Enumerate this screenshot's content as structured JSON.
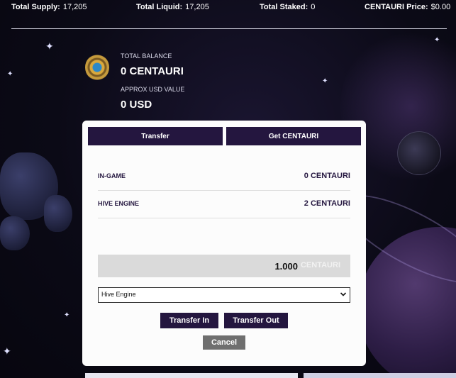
{
  "stats": {
    "total_supply": {
      "label": "Total Supply:",
      "value": "17,205"
    },
    "total_liquid": {
      "label": "Total Liquid:",
      "value": "17,205"
    },
    "total_staked": {
      "label": "Total Staked:",
      "value": "0"
    },
    "price": {
      "label": "CENTAURI Price:",
      "value": "$0.00"
    }
  },
  "balance": {
    "coin_icon": "centauri-coin-icon",
    "total_label": "TOTAL BALANCE",
    "total_value": "0 CENTAURI",
    "usd_label": "APPROX USD VALUE",
    "usd_value": "0 USD"
  },
  "card": {
    "tabs": [
      {
        "label": "Transfer"
      },
      {
        "label": "Get CENTAURI"
      }
    ],
    "rows": [
      {
        "label": "IN-GAME",
        "amount": "0 CENTAURI"
      },
      {
        "label": "HIVE ENGINE",
        "amount": "2 CENTAURI"
      }
    ],
    "amount_input": {
      "value": "1.000",
      "unit": "CENTAURI"
    },
    "source_select": {
      "selected": "Hive Engine"
    },
    "buttons": {
      "transfer_in": "Transfer In",
      "transfer_out": "Transfer Out",
      "cancel": "Cancel"
    }
  },
  "colors": {
    "accent": "#24163f",
    "cancel": "#6f6f6f",
    "card_bg": "#fcfcfc",
    "input_bg": "#dadada"
  }
}
